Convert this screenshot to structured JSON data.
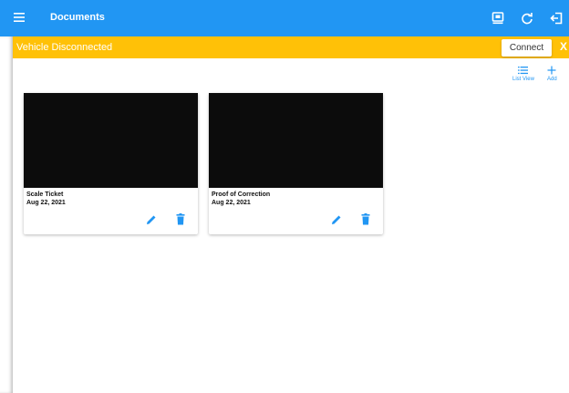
{
  "appbar": {
    "title": "Documents",
    "bg_color": "#2196f3",
    "icons": [
      "menu-icon",
      "vehicle-monitor-icon",
      "refresh-icon",
      "logout-icon"
    ]
  },
  "banner": {
    "text": "Vehicle Disconnected",
    "connect_label": "Connect",
    "close_label": "X",
    "bg_color": "#ffc107"
  },
  "toolbar": {
    "list_view_label": "List View",
    "add_label": "Add",
    "list_view_icon": "list-icon",
    "add_icon": "plus-icon"
  },
  "documents": [
    {
      "title": "Scale Ticket",
      "date": "Aug 22, 2021"
    },
    {
      "title": "Proof of Correction",
      "date": "Aug 22, 2021"
    }
  ],
  "accent_color": "#2196f3"
}
